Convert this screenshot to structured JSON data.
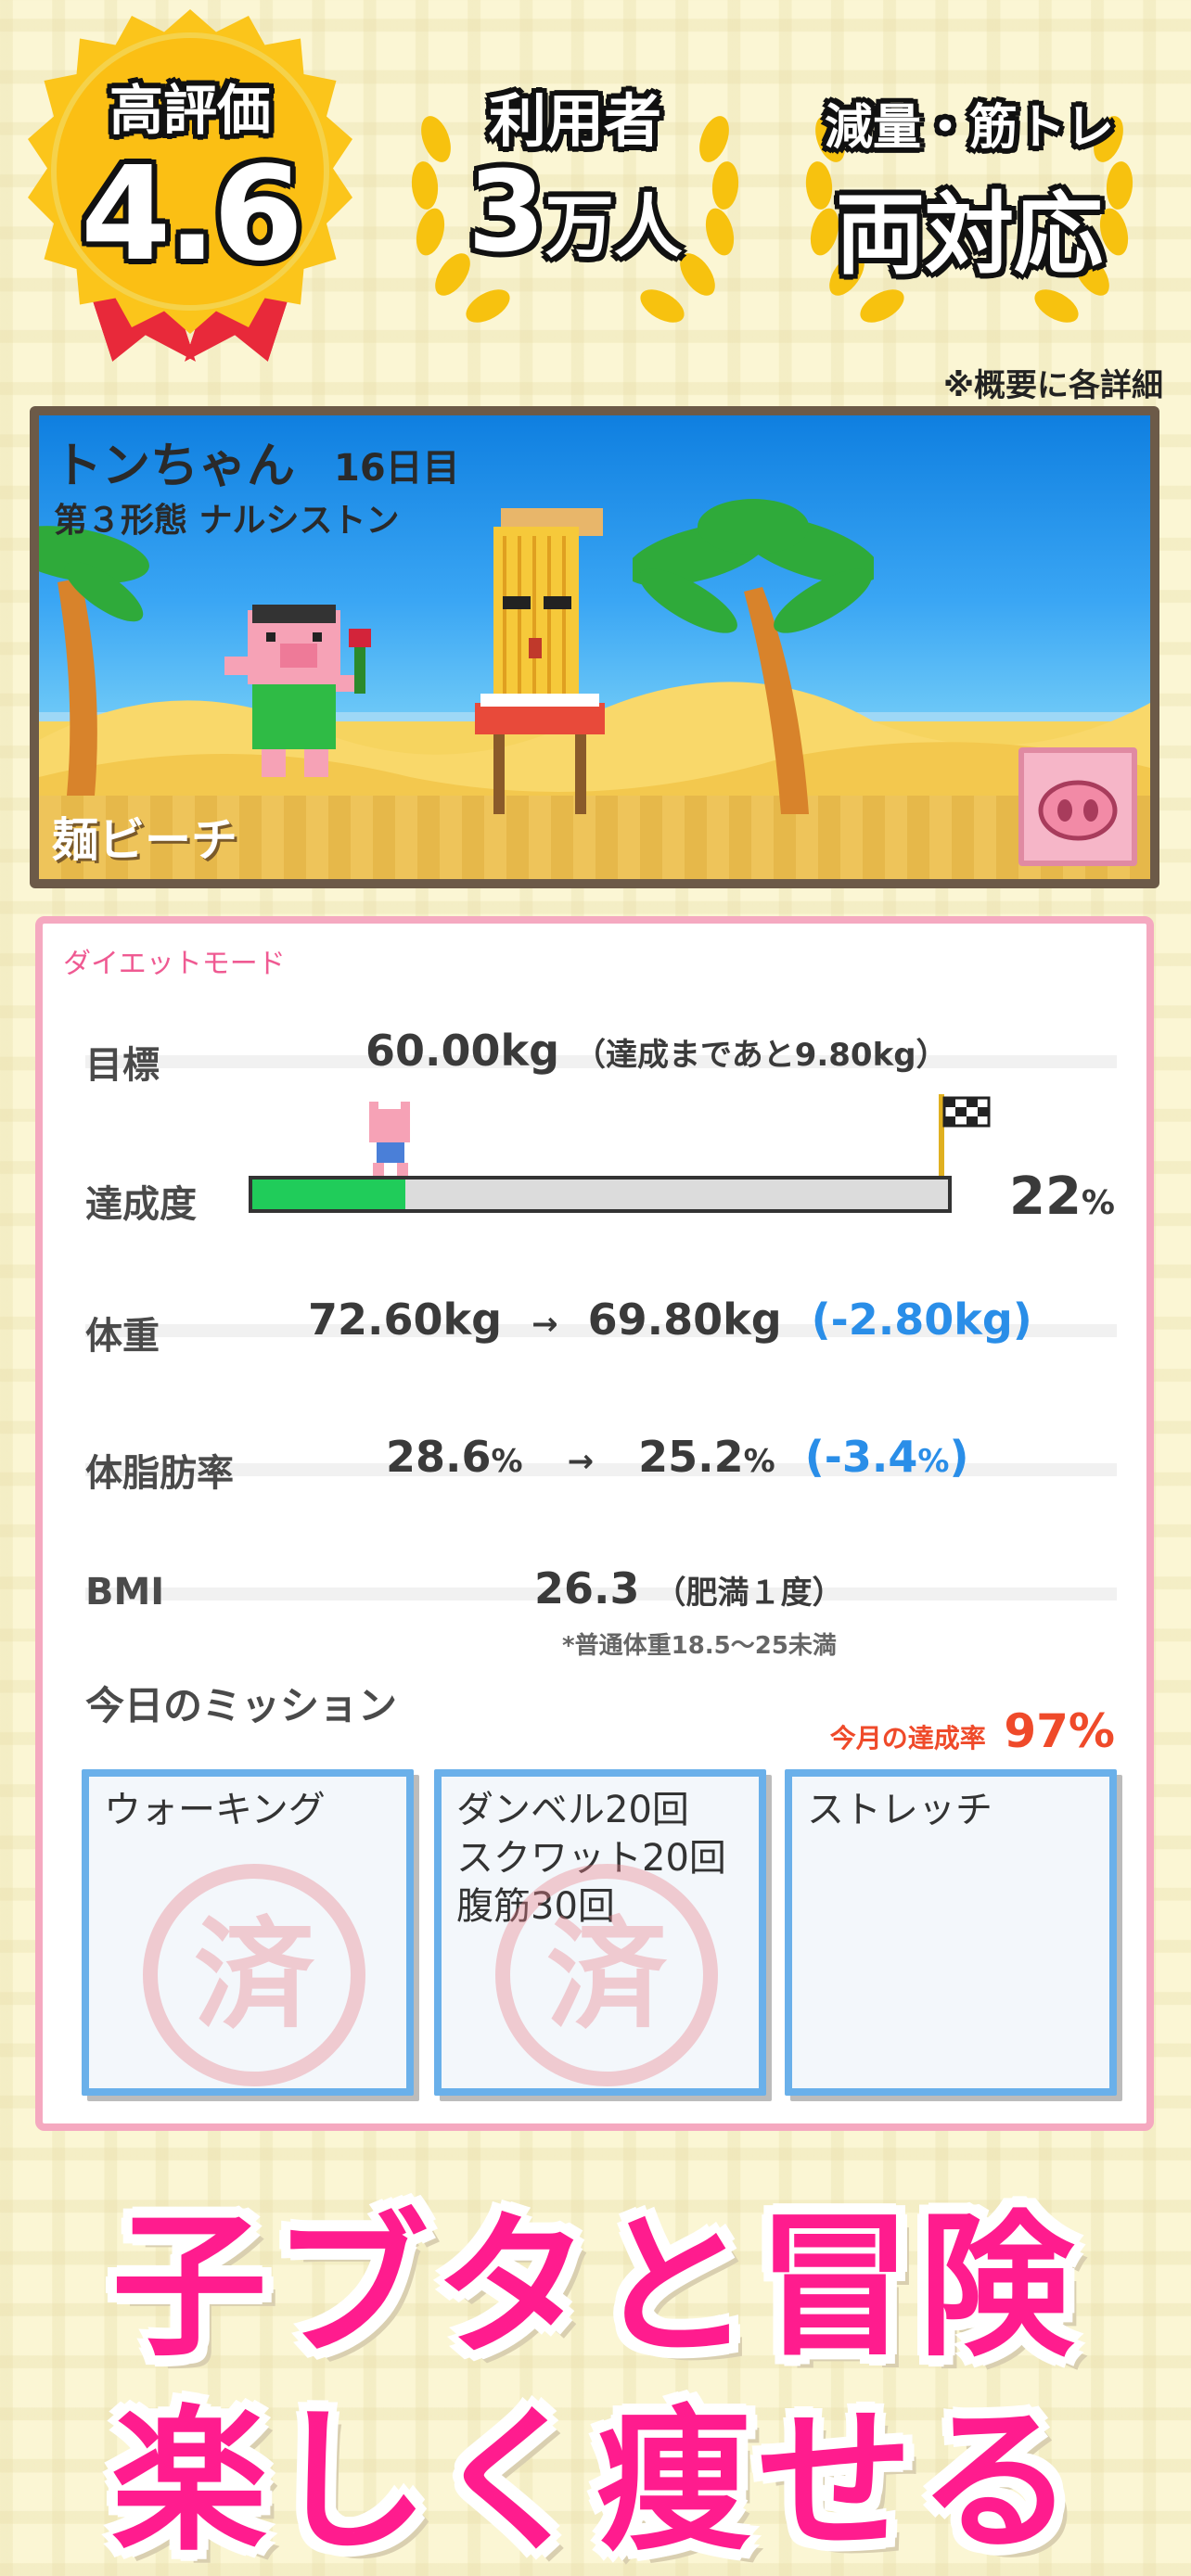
{
  "badges": {
    "rating": {
      "label": "高評価",
      "value": "4.6"
    },
    "users": {
      "label": "利用者",
      "value": "3",
      "unit": "万人"
    },
    "support": {
      "label": "減量・筋トレ",
      "value": "両対応"
    },
    "note": "※概要に各詳細"
  },
  "scene": {
    "character_name": "トンちゃん",
    "day": "16日目",
    "form": "第３形態 ナルシストン",
    "location": "麺ビーチ",
    "pig_button_icon": "pig-face-icon"
  },
  "stats": {
    "mode": "ダイエットモード",
    "goal": {
      "label": "目標",
      "value": "60.00kg",
      "remaining": "（達成まであと9.80kg）"
    },
    "progress": {
      "label": "達成度",
      "percent_value": 22,
      "percent_text": "22",
      "percent_unit": "%"
    },
    "weight": {
      "label": "体重",
      "from": "72.60kg",
      "arrow": "→",
      "to": "69.80kg",
      "diff": "(-2.80kg)"
    },
    "body_fat": {
      "label": "体脂肪率",
      "from": "28.6",
      "from_unit": "%",
      "arrow": "→",
      "to": "25.2",
      "to_unit": "%",
      "diff": "(-3.4",
      "diff_unit": "%",
      "diff_close": ")"
    },
    "bmi": {
      "label": "BMI",
      "value": "26.3",
      "category": "（肥満１度）",
      "note": "*普通体重18.5〜25未満"
    }
  },
  "missions": {
    "title": "今日のミッション",
    "month_rate_label": "今月の達成率",
    "month_rate_value": "97%",
    "items": [
      {
        "name": "ウォーキング",
        "done": true,
        "stamp": "済"
      },
      {
        "name": "ダンベル20回\nスクワット20回\n腹筋30回",
        "done": true,
        "stamp": "済"
      },
      {
        "name": "ストレッチ",
        "done": false,
        "stamp": ""
      }
    ]
  },
  "headline": {
    "line1": "子ブタと冒険",
    "line2": "楽しく痩せる"
  },
  "colors": {
    "accent_pink": "#ff1c8e",
    "progress_green": "#20cc5a",
    "diff_blue": "#2a8ee8",
    "badge_gold": "#fbc51b",
    "panel_border": "#f5a9c0"
  }
}
